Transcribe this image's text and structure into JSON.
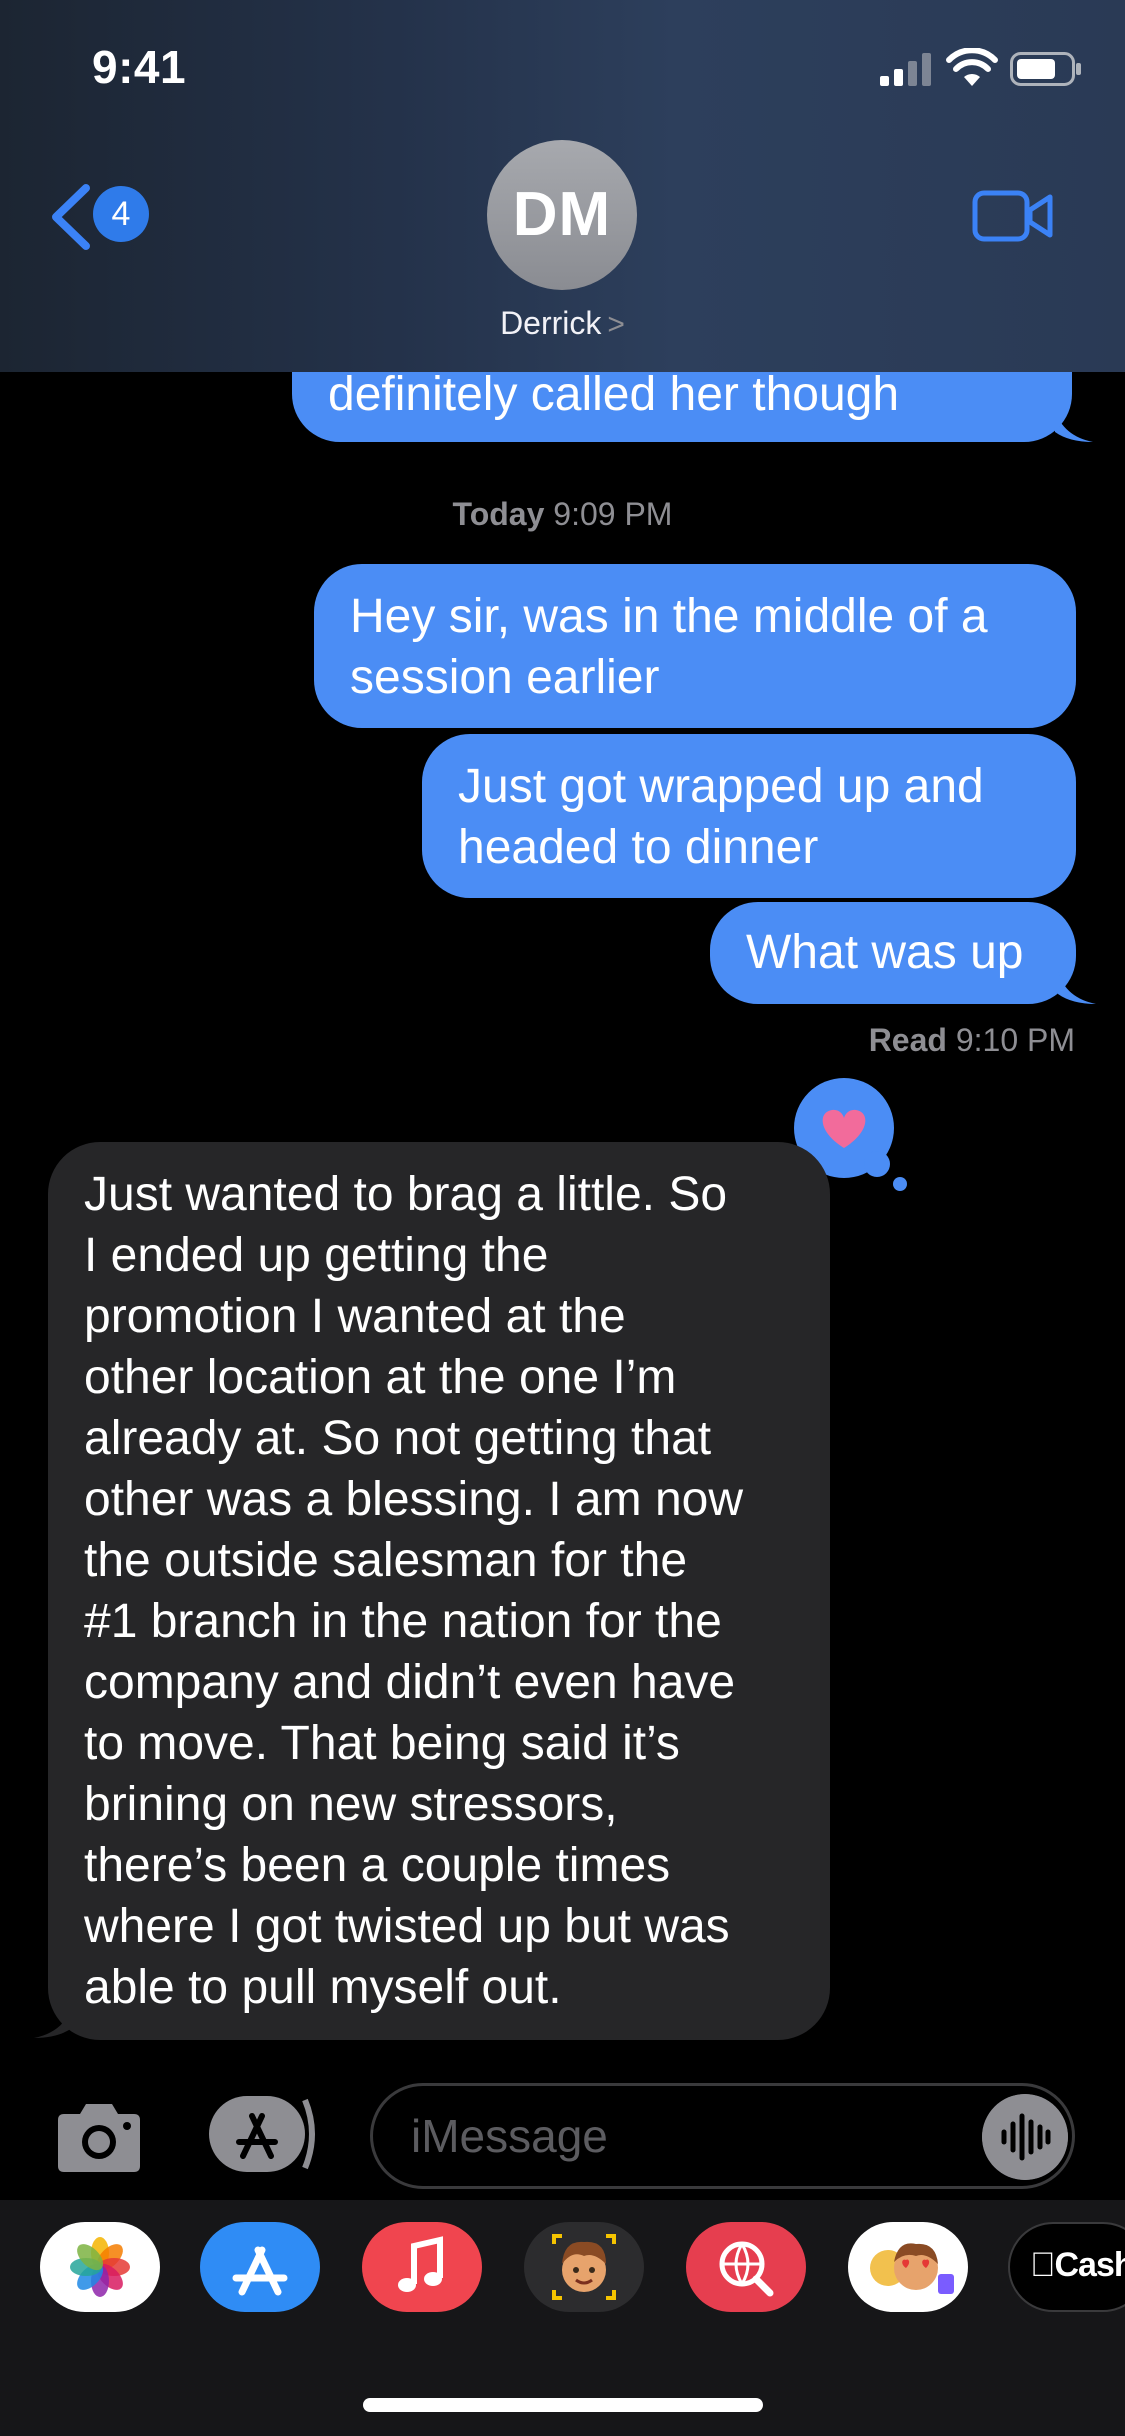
{
  "status_bar": {
    "time": "9:41"
  },
  "header": {
    "back_badge": "4",
    "avatar_initials": "DM",
    "contact_name": "Derrick",
    "name_chevron": ">",
    "icons": [
      "chevron-left-icon",
      "video-camera-icon"
    ]
  },
  "messages": {
    "partial_sent": "definitely called her though",
    "timestamp": {
      "day": "Today",
      "time": "9:09 PM"
    },
    "sent": [
      {
        "line1": "Hey sir, was in the middle of a",
        "line2": "session earlier"
      },
      {
        "line1": "Just got wrapped up and",
        "line2": "headed to dinner"
      },
      {
        "line1": "What was up"
      }
    ],
    "read_receipt": {
      "label": "Read",
      "time": "9:10 PM"
    },
    "reaction": "heart",
    "received_lines": [
      "Just wanted to brag a little. So",
      "I ended up getting the",
      "promotion I wanted at the",
      "other location at the one I’m",
      "already at. So not getting that",
      "other was a blessing. I am now",
      "the outside salesman for the",
      "#1 branch in the nation for the",
      "company and didn’t even have",
      "to move. That being said it’s",
      "brining on new stressors,",
      "there’s been a couple times",
      "where I got twisted up but was",
      "able to pull myself out."
    ]
  },
  "input_bar": {
    "placeholder": "iMessage"
  },
  "app_drawer": {
    "apps": [
      "photos-icon",
      "app-store-icon",
      "music-icon",
      "memoji-icon",
      "web-search-icon",
      "memoji-stickers-icon",
      "apple-cash-icon"
    ],
    "cash_label": "Cash"
  },
  "colors": {
    "sent_bubble": "#4b8df5",
    "received_bubble": "#262628",
    "accent": "#2f7bea"
  }
}
